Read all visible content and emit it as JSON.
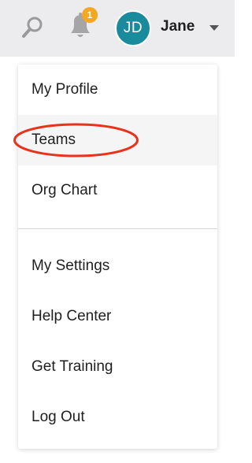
{
  "topbar": {
    "search_icon": "search-icon",
    "bell_icon": "bell-icon",
    "notification_count": "1",
    "avatar_initials": "JD",
    "user_name": "Jane",
    "dropdown_icon": "caret-down-icon"
  },
  "menu": {
    "items": [
      {
        "label": "My Profile"
      },
      {
        "label": "Teams"
      },
      {
        "label": "Org Chart"
      },
      {
        "label": "My Settings"
      },
      {
        "label": "Help Center"
      },
      {
        "label": "Get Training"
      },
      {
        "label": "Log Out"
      }
    ],
    "active_item": "Teams"
  },
  "colors": {
    "topbar_bg": "#ececee",
    "avatar_bg": "#1a8b9d",
    "badge_bg": "#f5a623",
    "highlight_ring": "#e8321c",
    "active_item_bg": "#f5f5f6"
  }
}
